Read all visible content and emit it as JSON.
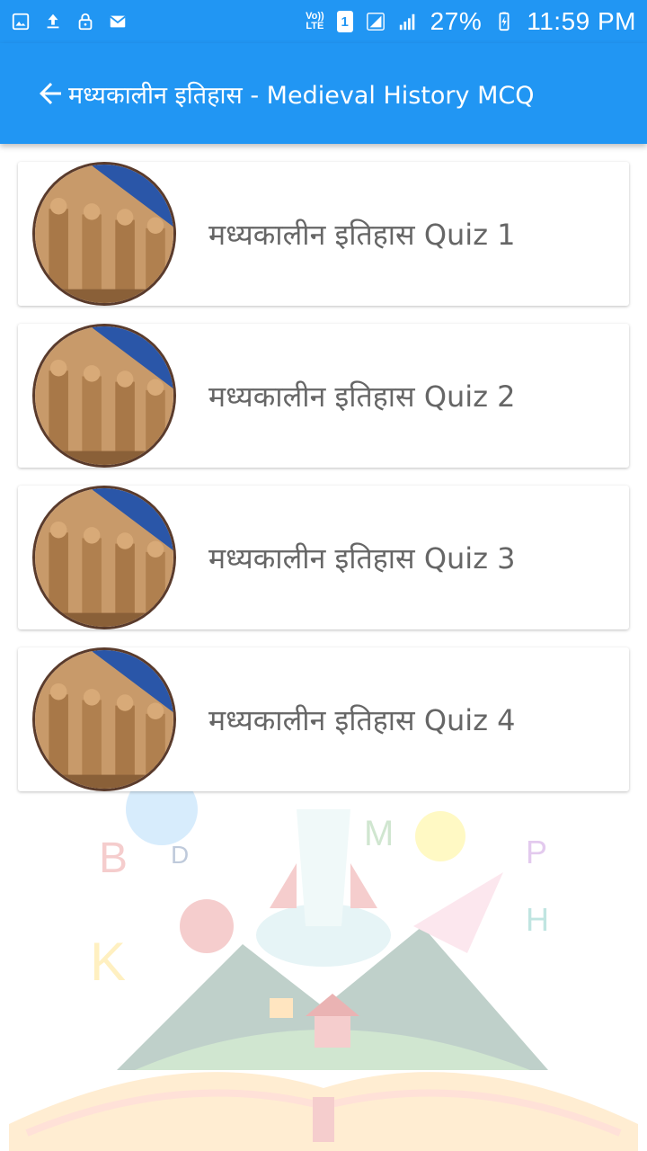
{
  "status_bar": {
    "icons_left": [
      "gallery-icon",
      "upload-icon",
      "lock-icon",
      "mail-icon"
    ],
    "volte_label_1": "Vo))",
    "volte_label_2": "LTE",
    "sim_label": "1",
    "battery": "27%",
    "time": "11:59 PM"
  },
  "app_bar": {
    "title": "मध्यकालीन इतिहास - Medieval History MCQ"
  },
  "quizzes": [
    {
      "label": "मध्यकालीन इतिहास Quiz 1"
    },
    {
      "label": "मध्यकालीन इतिहास Quiz 2"
    },
    {
      "label": "मध्यकालीन इतिहास Quiz 3"
    },
    {
      "label": "मध्यकालीन इतिहास Quiz 4"
    }
  ],
  "colors": {
    "primary": "#2196f3",
    "label_text": "#666666",
    "thumb_border": "#5a3b2c"
  }
}
